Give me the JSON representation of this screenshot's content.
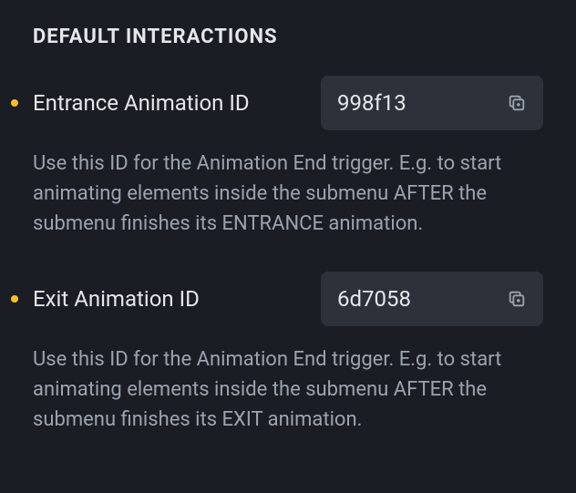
{
  "section": {
    "title": "DEFAULT INTERACTIONS"
  },
  "fields": {
    "entrance": {
      "label": "Entrance Animation ID",
      "value": "998f13",
      "description": "Use this ID for the Animation End trigger. E.g. to start animating elements inside the submenu AFTER the submenu finishes its ENTRANCE animation."
    },
    "exit": {
      "label": "Exit Animation ID",
      "value": "6d7058",
      "description": "Use this ID for the Animation End trigger. E.g. to start animating elements inside the submenu AFTER the submenu finishes its EXIT animation."
    }
  }
}
